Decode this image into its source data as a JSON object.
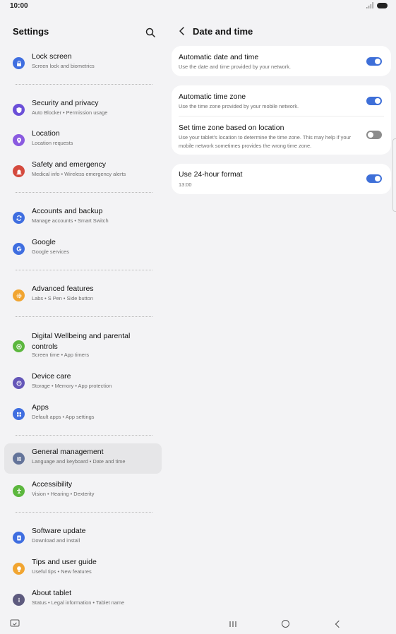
{
  "status_bar": {
    "time": "10:00"
  },
  "left": {
    "title": "Settings",
    "items": [
      {
        "title": "Lock screen",
        "sub": "Screen lock and biometrics",
        "color": "#3f6ee0",
        "icon": "lock-icon"
      },
      {
        "title": "Security and privacy",
        "sub": "Auto Blocker • Permission usage",
        "color": "#6b4fd8",
        "icon": "shield-icon"
      },
      {
        "title": "Location",
        "sub": "Location requests",
        "color": "#8a5ae0",
        "icon": "location-pin-icon"
      },
      {
        "title": "Safety and emergency",
        "sub": "Medical info • Wireless emergency alerts",
        "color": "#d44a3e",
        "icon": "siren-icon"
      },
      {
        "title": "Accounts and backup",
        "sub": "Manage accounts • Smart Switch",
        "color": "#3f6ee0",
        "icon": "sync-icon"
      },
      {
        "title": "Google",
        "sub": "Google services",
        "color": "#3f6ee0",
        "icon": "google-icon"
      },
      {
        "title": "Advanced features",
        "sub": "Labs • S Pen • Side button",
        "color": "#f1a531",
        "icon": "gear-plus-icon"
      },
      {
        "title": "Digital Wellbeing and parental controls",
        "sub": "Screen time • App timers",
        "color": "#5cb73e",
        "icon": "wellbeing-icon"
      },
      {
        "title": "Device care",
        "sub": "Storage • Memory • App protection",
        "color": "#6456b8",
        "icon": "device-care-icon"
      },
      {
        "title": "Apps",
        "sub": "Default apps • App settings",
        "color": "#3f6ee0",
        "icon": "apps-grid-icon"
      },
      {
        "title": "General management",
        "sub": "Language and keyboard • Date and time",
        "color": "#64749a",
        "icon": "sliders-icon"
      },
      {
        "title": "Accessibility",
        "sub": "Vision • Hearing • Dexterity",
        "color": "#5cb73e",
        "icon": "accessibility-icon"
      },
      {
        "title": "Software update",
        "sub": "Download and install",
        "color": "#3f6ee0",
        "icon": "update-icon"
      },
      {
        "title": "Tips and user guide",
        "sub": "Useful tips • New features",
        "color": "#f1a531",
        "icon": "lightbulb-icon"
      },
      {
        "title": "About tablet",
        "sub": "Status • Legal information • Tablet name",
        "color": "#5d5a7e",
        "icon": "info-icon"
      }
    ]
  },
  "right": {
    "title": "Date and time",
    "auto_date": {
      "title": "Automatic date and time",
      "sub": "Use the date and time provided by your network.",
      "on": true
    },
    "auto_zone": {
      "title": "Automatic time zone",
      "sub": "Use the time zone provided by your mobile network.",
      "on": true
    },
    "zone_location": {
      "title": "Set time zone based on location",
      "sub": "Use your tablet's location to determine the time zone. This may help if your mobile network sometimes provides the wrong time zone.",
      "on": false
    },
    "format_24": {
      "title": "Use 24-hour format",
      "sub": "13:00",
      "on": true
    }
  },
  "colors": {
    "accent": "#3e6fd8",
    "selected_bg": "#e6e6e8",
    "background": "#f3f3f5"
  }
}
